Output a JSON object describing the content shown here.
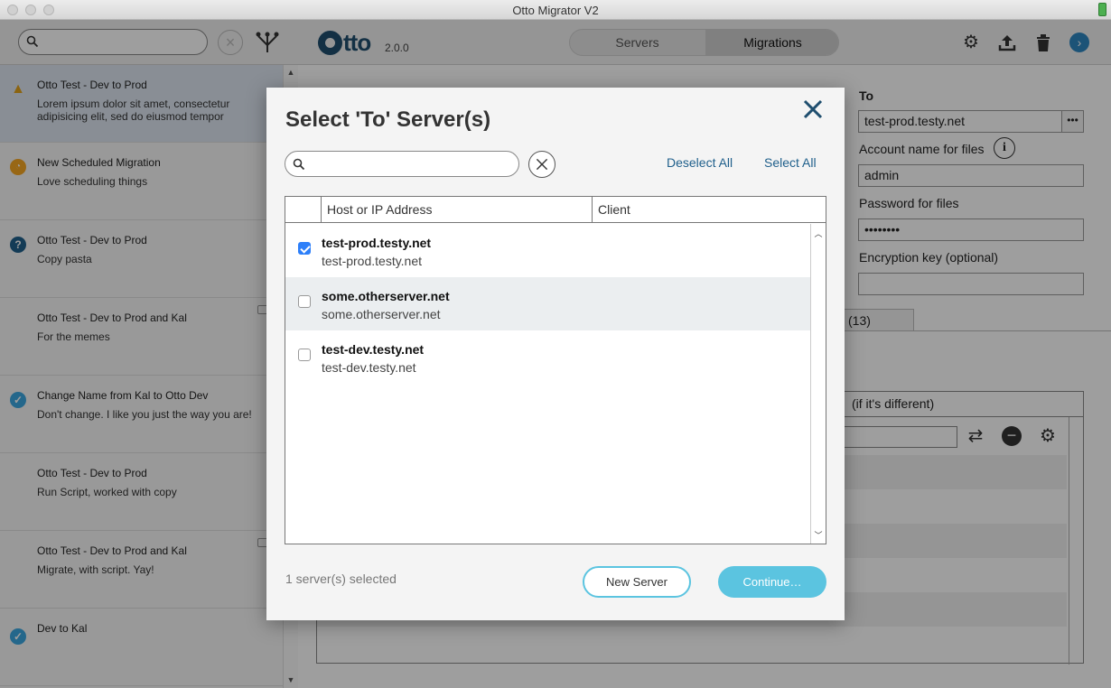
{
  "window": {
    "title": "Otto Migrator V2"
  },
  "sidebar": {
    "items": [
      {
        "title": "Otto Test - Dev to Prod",
        "desc": "Lorem ipsum dolor sit amet, consectetur adipisicing elit, sed do eiusmod tempor",
        "status": "warning-icon",
        "status_glyph": "!",
        "status_color": "#e0a21c"
      },
      {
        "title": "New Scheduled Migration",
        "desc": "Love scheduling things",
        "status": "clock-icon",
        "status_glyph": "",
        "status_color": "#f5a623"
      },
      {
        "title": "Otto Test - Dev to Prod",
        "desc": "Copy pasta",
        "status": "question-icon",
        "status_glyph": "?",
        "status_color": "#1f5f8b"
      },
      {
        "title": "Otto Test - Dev to Prod and Kal",
        "desc": "For the memes",
        "status": "none",
        "status_glyph": "",
        "status_color": ""
      },
      {
        "title": "Change Name from Kal to Otto Dev",
        "desc": "Don't change. I like you just the way you are!",
        "status": "check-icon",
        "status_glyph": "✓",
        "status_color": "#3aa7e0"
      },
      {
        "title": "Otto Test - Dev to Prod",
        "desc": "Run Script, worked with copy",
        "status": "none",
        "status_glyph": "",
        "status_color": ""
      },
      {
        "title": "Otto Test - Dev to Prod and Kal",
        "desc": "Migrate, with script. Yay!",
        "status": "none",
        "status_glyph": "",
        "status_color": ""
      },
      {
        "title": "Dev to Kal",
        "desc": "",
        "status": "check-icon",
        "status_glyph": "✓",
        "status_color": "#3aa7e0"
      }
    ]
  },
  "header": {
    "logo_text": "tto",
    "version": "2.0.0",
    "tabs": [
      "Servers",
      "Migrations"
    ],
    "active_tab": "Migrations"
  },
  "to_form": {
    "heading": "To",
    "server_value": "test-prod.testy.net",
    "more_label": "•••",
    "account_label": "Account name for files",
    "account_value": "admin",
    "password_label": "Password for files",
    "password_value": "••••••••",
    "encryption_label": "Encryption key (optional)",
    "encryption_value": "",
    "tab_fragment": "(13)",
    "diff_fragment": "(if it's different)"
  },
  "modal": {
    "title": "Select 'To' Server(s)",
    "search_placeholder": "",
    "deselect_all": "Deselect All",
    "select_all": "Select All",
    "columns": [
      "Host or IP Address",
      "Client"
    ],
    "rows": [
      {
        "host": "test-prod.testy.net",
        "sub": "test-prod.testy.net",
        "checked": true
      },
      {
        "host": "some.otherserver.net",
        "sub": "some.otherserver.net",
        "checked": false
      },
      {
        "host": "test-dev.testy.net",
        "sub": "test-dev.testy.net",
        "checked": false
      }
    ],
    "selected_count": "1 server(s) selected",
    "new_server": "New Server",
    "continue": "Continue…"
  },
  "colors": {
    "accent": "#5bc4e0",
    "link": "#1f5f8b",
    "checkbox": "#2d7ff9",
    "brand": "#1f4e6e"
  }
}
